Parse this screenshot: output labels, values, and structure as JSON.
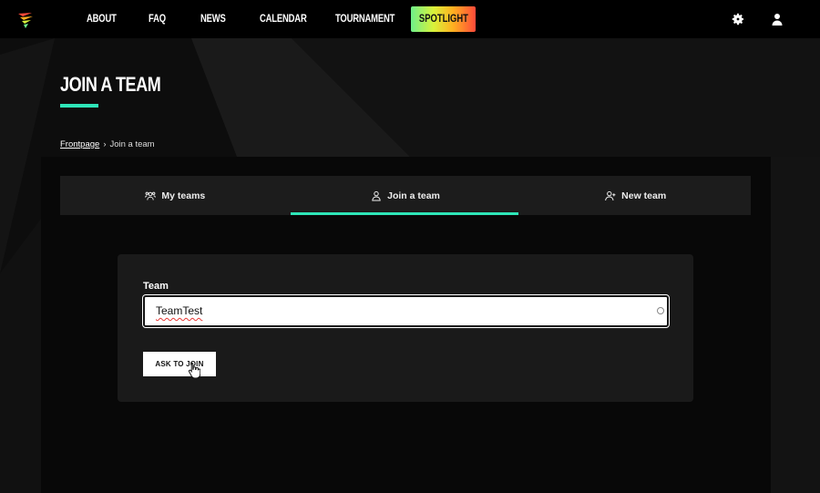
{
  "nav": {
    "items": [
      "ABOUT",
      "FAQ",
      "NEWS",
      "CALENDAR",
      "TOURNAMENT"
    ],
    "spotlight": "SPOTLIGHT",
    "icons": [
      "gear-icon",
      "user-icon"
    ]
  },
  "page": {
    "title": "JOIN A TEAM",
    "accent_color": "#2ee6b8"
  },
  "breadcrumb": {
    "home": "Frontpage",
    "separator": "›",
    "current": "Join a team"
  },
  "tabs": [
    {
      "label": "My teams",
      "icon": "team-icon",
      "active": false
    },
    {
      "label": "Join a team",
      "icon": "user-icon",
      "active": true
    },
    {
      "label": "New team",
      "icon": "user-plus-icon",
      "active": false
    }
  ],
  "form": {
    "label": "Team",
    "value": "TeamTest",
    "button": "ASK TO JOIN"
  }
}
